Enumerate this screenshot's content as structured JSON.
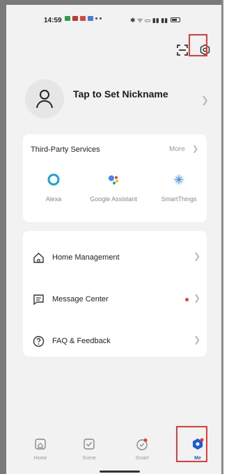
{
  "status_bar": {
    "time": "14:59",
    "right_text": "✱ ᯤ ▭ ▮▮ ▮▮"
  },
  "profile": {
    "nickname_prompt": "Tap to Set Nickname"
  },
  "services": {
    "title": "Third-Party Services",
    "more_label": "More",
    "items": [
      {
        "label": "Alexa",
        "icon": "alexa-icon"
      },
      {
        "label": "Google Assistant",
        "icon": "google-assistant-icon"
      },
      {
        "label": "SmartThings",
        "icon": "smartthings-icon"
      }
    ]
  },
  "menu": {
    "items": [
      {
        "label": "Home Management",
        "icon": "house-icon"
      },
      {
        "label": "Message Center",
        "icon": "message-icon",
        "badge": "unread-dot"
      },
      {
        "label": "FAQ & Feedback",
        "icon": "question-icon"
      }
    ]
  },
  "bottom_nav": {
    "items": [
      {
        "label": "Home",
        "icon": "home-icon"
      },
      {
        "label": "Scene",
        "icon": "scene-icon"
      },
      {
        "label": "Smart",
        "icon": "smart-icon"
      },
      {
        "label": "Me",
        "icon": "me-icon",
        "selected": true
      }
    ]
  },
  "colors": {
    "accent": "#1e5bd8",
    "highlight_box": "#e23b3b",
    "background": "#f2f2f2",
    "card": "#ffffff"
  }
}
